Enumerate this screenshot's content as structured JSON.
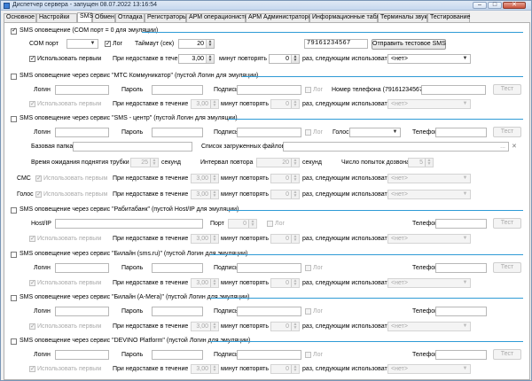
{
  "window": {
    "title": "Диспетчер сервера - запущен 08.07.2022 13:16:54",
    "minimize": "–",
    "maximize": "□",
    "close": "✕"
  },
  "tabs": [
    "Основное",
    "Настройки",
    "SMS",
    "Обмен",
    "Отладка",
    "Регистраторы",
    "АРМ операционистов",
    "АРМ Администраторов",
    "Информационные табло",
    "Терминалы звука",
    "Тестирование"
  ],
  "common": {
    "login": "Логин",
    "password": "Пароль",
    "signature": "Подпись",
    "log": "Лог",
    "phone_label": "Номер телефона (79161234567)",
    "telephone": "Телефон",
    "test": "Тест",
    "use_first": "Использовать первым",
    "if_not_delivered": "При недоставке в течение",
    "minutes_repeat": "минут повторять",
    "times_next_use": "раз, следующим использовать",
    "delivery_minutes": "3,00",
    "repeat_count": "0",
    "next_service": "<нет>",
    "voice": "Голос",
    "sms": "СМС",
    "port": "Порт",
    "host": "Host/IP",
    "port_value": "0"
  },
  "s1": {
    "title": "SMS оповещение (COM порт = 0 для эмуляции)",
    "com_port": "COM порт",
    "timeout": "Таймаут (сек)",
    "timeout_value": "20",
    "phone_value": "79161234567",
    "send_test": "Отправить тестовое SMS"
  },
  "s2": {
    "title": "SMS оповещение через сервис \"МТС Коммуникатор\" (пустой Логин для эмуляции)",
    "phone_label": "Номер телефона (79161234567)"
  },
  "s3": {
    "title": "SMS оповещение через сервис \"SMS - центр\" (пустой Логин для эмуляции)",
    "base_folder": "Базовая папка",
    "loaded_files": "Список загруженных файлов",
    "ellipsis": "...",
    "clear": "✕",
    "wait_pickup": "Время ожидания поднятия трубки",
    "wait_value": "25",
    "seconds": "секунд",
    "repeat_interval": "Интервал повтора",
    "interval_value": "20",
    "dial_attempts": "Число попыток дозвона",
    "attempts_value": "5"
  },
  "s4": {
    "title": "SMS оповещение через сервис \"Рабитабанк\" (пустой Host/IP для эмуляции)"
  },
  "s5": {
    "title": "SMS оповещение через сервис \"Билайн (sms.ru)\" (пустой Логин для эмуляции)"
  },
  "s6": {
    "title": "SMS оповещение через сервис \"Билайн (А-Мега)\" (пустой Логин для эмуляции)"
  },
  "s7": {
    "title": "SMS оповещение через сервис \"DEVINO Platform\" (пустой Логин для эмуляции)"
  }
}
